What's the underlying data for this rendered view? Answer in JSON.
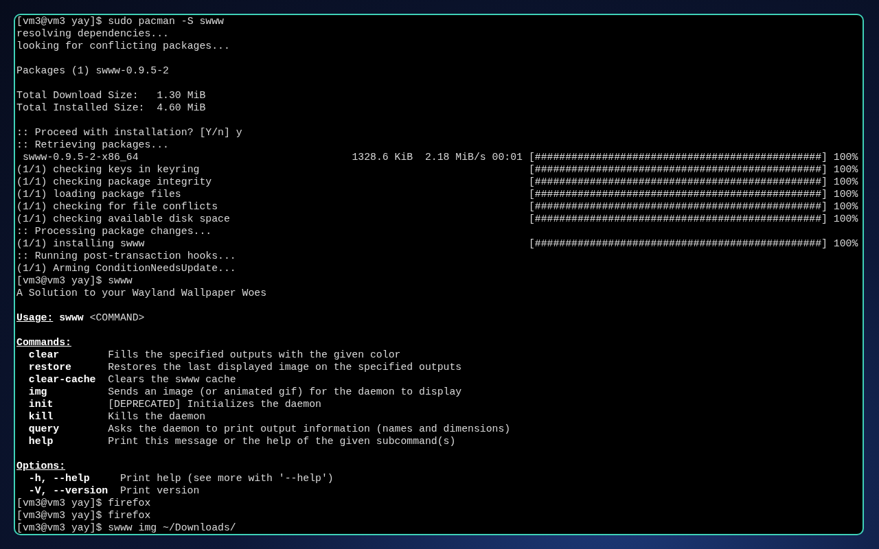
{
  "terminal": {
    "lines": [
      {
        "kind": "text",
        "text": "[vm3@vm3 yay]$ sudo pacman -S swww"
      },
      {
        "kind": "text",
        "text": "resolving dependencies..."
      },
      {
        "kind": "text",
        "text": "looking for conflicting packages..."
      },
      {
        "kind": "blank"
      },
      {
        "kind": "text",
        "text": "Packages (1) swww-0.9.5-2"
      },
      {
        "kind": "blank"
      },
      {
        "kind": "text",
        "text": "Total Download Size:   1.30 MiB"
      },
      {
        "kind": "text",
        "text": "Total Installed Size:  4.60 MiB"
      },
      {
        "kind": "blank"
      },
      {
        "kind": "text",
        "text": ":: Proceed with installation? [Y/n] y"
      },
      {
        "kind": "text",
        "text": ":: Retrieving packages..."
      },
      {
        "kind": "progress",
        "label": "swww-0.9.5-2-x86_64",
        "stats": "1328.6 KiB  2.18 MiB/s 00:01",
        "bar": "[###############################################]",
        "percent": "100%"
      },
      {
        "kind": "progress",
        "label": "(1/1) checking keys in keyring",
        "bar": "[###############################################]",
        "percent": "100%"
      },
      {
        "kind": "progress",
        "label": "(1/1) checking package integrity",
        "bar": "[###############################################]",
        "percent": "100%"
      },
      {
        "kind": "progress",
        "label": "(1/1) loading package files",
        "bar": "[###############################################]",
        "percent": "100%"
      },
      {
        "kind": "progress",
        "label": "(1/1) checking for file conflicts",
        "bar": "[###############################################]",
        "percent": "100%"
      },
      {
        "kind": "progress",
        "label": "(1/1) checking available disk space",
        "bar": "[###############################################]",
        "percent": "100%"
      },
      {
        "kind": "text",
        "text": ":: Processing package changes..."
      },
      {
        "kind": "progress",
        "label": "(1/1) installing swww",
        "bar": "[###############################################]",
        "percent": "100%"
      },
      {
        "kind": "text",
        "text": ":: Running post-transaction hooks..."
      },
      {
        "kind": "text",
        "text": "(1/1) Arming ConditionNeedsUpdate..."
      },
      {
        "kind": "text",
        "text": "[vm3@vm3 yay]$ swww"
      },
      {
        "kind": "text",
        "text": "A Solution to your Wayland Wallpaper Woes"
      },
      {
        "kind": "blank"
      },
      {
        "kind": "usage",
        "heading": "Usage:",
        "command": "swww",
        "argument": "<COMMAND>"
      },
      {
        "kind": "blank"
      },
      {
        "kind": "heading",
        "text": "Commands:"
      },
      {
        "kind": "command",
        "name": "clear",
        "description": "Fills the specified outputs with the given color"
      },
      {
        "kind": "command",
        "name": "restore",
        "description": "Restores the last displayed image on the specified outputs"
      },
      {
        "kind": "command",
        "name": "clear-cache",
        "description": "Clears the swww cache"
      },
      {
        "kind": "command",
        "name": "img",
        "description": "Sends an image (or animated gif) for the daemon to display"
      },
      {
        "kind": "command",
        "name": "init",
        "description": "[DEPRECATED] Initializes the daemon"
      },
      {
        "kind": "command",
        "name": "kill",
        "description": "Kills the daemon"
      },
      {
        "kind": "command",
        "name": "query",
        "description": "Asks the daemon to print output information (names and dimensions)"
      },
      {
        "kind": "command",
        "name": "help",
        "description": "Print this message or the help of the given subcommand(s)"
      },
      {
        "kind": "blank"
      },
      {
        "kind": "heading",
        "text": "Options:"
      },
      {
        "kind": "option",
        "name": "-h, --help",
        "description": "Print help (see more with '--help')"
      },
      {
        "kind": "option",
        "name": "-V, --version",
        "description": "Print version"
      },
      {
        "kind": "text",
        "text": "[vm3@vm3 yay]$ firefox"
      },
      {
        "kind": "text",
        "text": "[vm3@vm3 yay]$ firefox"
      },
      {
        "kind": "text",
        "text": "[vm3@vm3 yay]$ swww img ~/Downloads/"
      }
    ]
  }
}
